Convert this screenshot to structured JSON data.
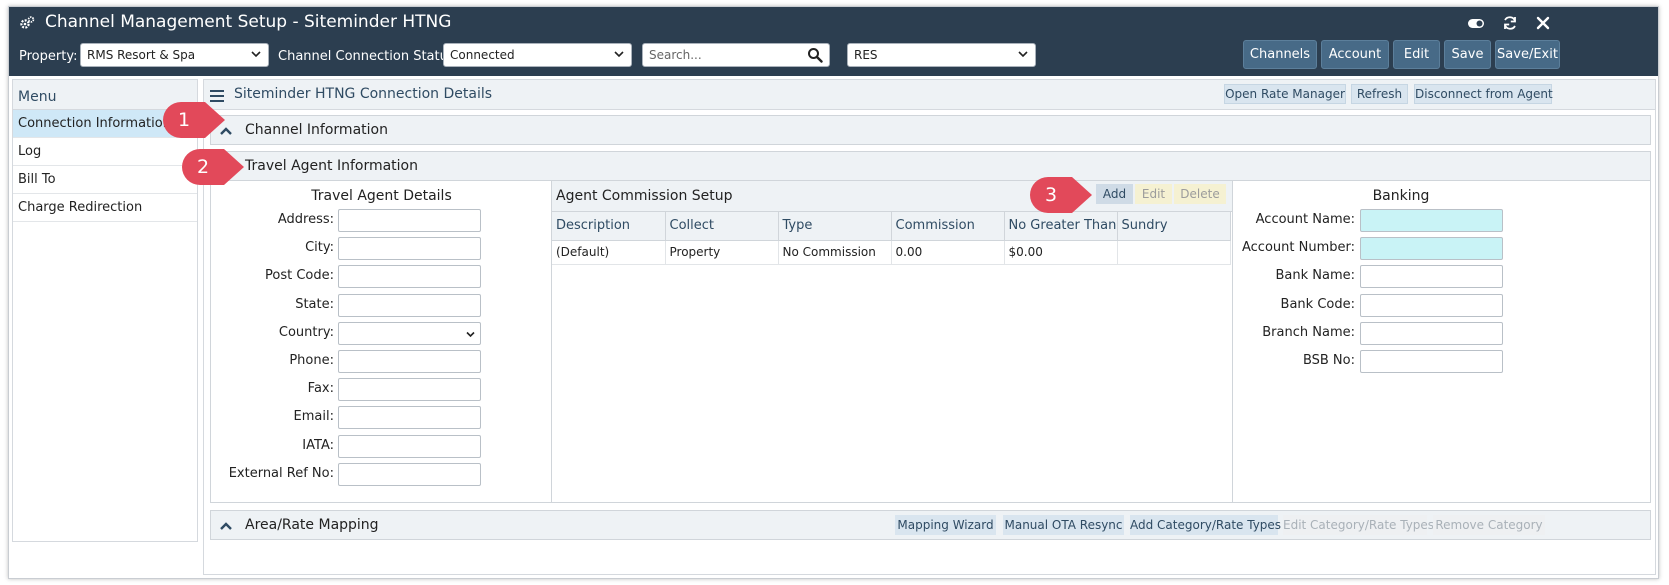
{
  "titlebar": {
    "title": "Channel Management Setup - Siteminder HTNG",
    "icons": [
      "cogs-icon",
      "toggle-icon",
      "refresh-icon",
      "close-icon"
    ]
  },
  "toolbar": {
    "property_label": "Property:",
    "property_value": "RMS Resort & Spa",
    "status_label": "Channel Connection Status:",
    "status_value": "Connected",
    "search_placeholder": "Search...",
    "res_value": "RES",
    "buttons": [
      "Channels",
      "Account",
      "Edit",
      "Save",
      "Save/Exit"
    ]
  },
  "menu": {
    "header": "Menu",
    "items": [
      "Connection Information",
      "Log",
      "Bill To",
      "Charge Redirection"
    ],
    "active_index": 0
  },
  "main": {
    "title": "Siteminder HTNG Connection Details",
    "header_buttons": [
      "Open Rate Manager",
      "Refresh",
      "Disconnect from Agent"
    ]
  },
  "sections": {
    "channel_info": "Channel Information",
    "travel_agent": "Travel Agent Information",
    "area_rate": "Area/Rate Mapping"
  },
  "travel_agent_details": {
    "title": "Travel Agent Details",
    "fields": [
      "Address:",
      "City:",
      "Post Code:",
      "State:",
      "Country:",
      "Phone:",
      "Fax:",
      "Email:",
      "IATA:",
      "External Ref No:"
    ]
  },
  "agent_commission": {
    "title": "Agent Commission Setup",
    "buttons": {
      "add": "Add",
      "edit": "Edit",
      "delete": "Delete"
    },
    "columns": [
      "Description",
      "Collect",
      "Type",
      "Commission",
      "No Greater Than",
      "Sundry"
    ],
    "rows": [
      [
        "(Default)",
        "Property",
        "No Commission",
        "0.00",
        "$0.00",
        ""
      ]
    ]
  },
  "banking": {
    "title": "Banking",
    "fields": [
      "Account Name:",
      "Account Number:",
      "Bank Name:",
      "Bank Code:",
      "Branch Name:",
      "BSB No:"
    ]
  },
  "area_rate_buttons": {
    "mapping_wizard": "Mapping Wizard",
    "manual_resync": "Manual OTA Resync",
    "add_category": "Add Category/Rate Types",
    "edit_category": "Edit Category/Rate Types",
    "remove_category": "Remove Category"
  },
  "callouts": [
    "1",
    "2",
    "3"
  ],
  "colors": {
    "header_bg": "#2c3e50",
    "button_bg": "#476a87",
    "active_menu": "#cfe8f7",
    "highlight_input": "#c9f3f6",
    "callout": "#e2495a"
  }
}
